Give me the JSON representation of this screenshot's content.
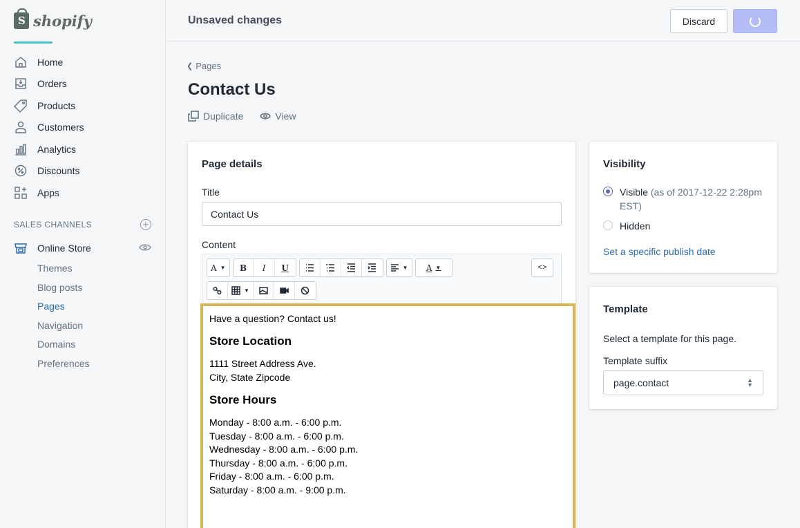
{
  "brand": {
    "logo_letter": "S",
    "name": "shopify"
  },
  "nav": {
    "items": [
      {
        "label": "Home",
        "icon": "home-icon"
      },
      {
        "label": "Orders",
        "icon": "orders-icon"
      },
      {
        "label": "Products",
        "icon": "tag-icon"
      },
      {
        "label": "Customers",
        "icon": "customers-icon"
      },
      {
        "label": "Analytics",
        "icon": "analytics-icon"
      },
      {
        "label": "Discounts",
        "icon": "discount-icon"
      },
      {
        "label": "Apps",
        "icon": "apps-icon"
      }
    ],
    "channels_title": "SALES CHANNELS",
    "store_label": "Online Store",
    "sub_items": [
      "Themes",
      "Blog posts",
      "Pages",
      "Navigation",
      "Domains",
      "Preferences"
    ],
    "active_sub": "Pages"
  },
  "topbar": {
    "status": "Unsaved changes",
    "discard_label": "Discard"
  },
  "page": {
    "breadcrumb": "Pages",
    "title": "Contact Us",
    "actions": {
      "duplicate": "Duplicate",
      "view": "View"
    }
  },
  "details": {
    "card_title": "Page details",
    "title_label": "Title",
    "title_value": "Contact Us",
    "content_label": "Content",
    "toolbar": {
      "font_label": "A",
      "bold": "B",
      "italic": "I",
      "underline": "U",
      "color_label": "A"
    },
    "content": {
      "intro": "Have a question? Contact us!",
      "heading_location": "Store Location",
      "address_line1": "1111 Street Address Ave.",
      "address_line2": "City, State Zipcode",
      "heading_hours": "Store Hours",
      "hours": [
        "Monday - 8:00 a.m. - 6:00 p.m.",
        "Tuesday - 8:00 a.m. - 6:00 p.m.",
        "Wednesday - 8:00 a.m. - 6:00 p.m.",
        "Thursday - 8:00 a.m. - 6:00 p.m.",
        "Friday - 8:00 a.m. - 6:00 p.m.",
        "Saturday - 8:00 a.m. - 9:00 p.m."
      ]
    }
  },
  "visibility": {
    "card_title": "Visibility",
    "visible_label": "Visible",
    "visible_note": "(as of 2017-12-22 2:28pm EST)",
    "hidden_label": "Hidden",
    "selected": "Visible",
    "publish_link": "Set a specific publish date"
  },
  "template": {
    "card_title": "Template",
    "description": "Select a template for this page.",
    "suffix_label": "Template suffix",
    "suffix_value": "page.contact"
  },
  "colors": {
    "accent": "#5c6ac4",
    "link": "#2a6aa8",
    "highlight_border": "#d6b656",
    "save_button": "#b3bcf5"
  }
}
